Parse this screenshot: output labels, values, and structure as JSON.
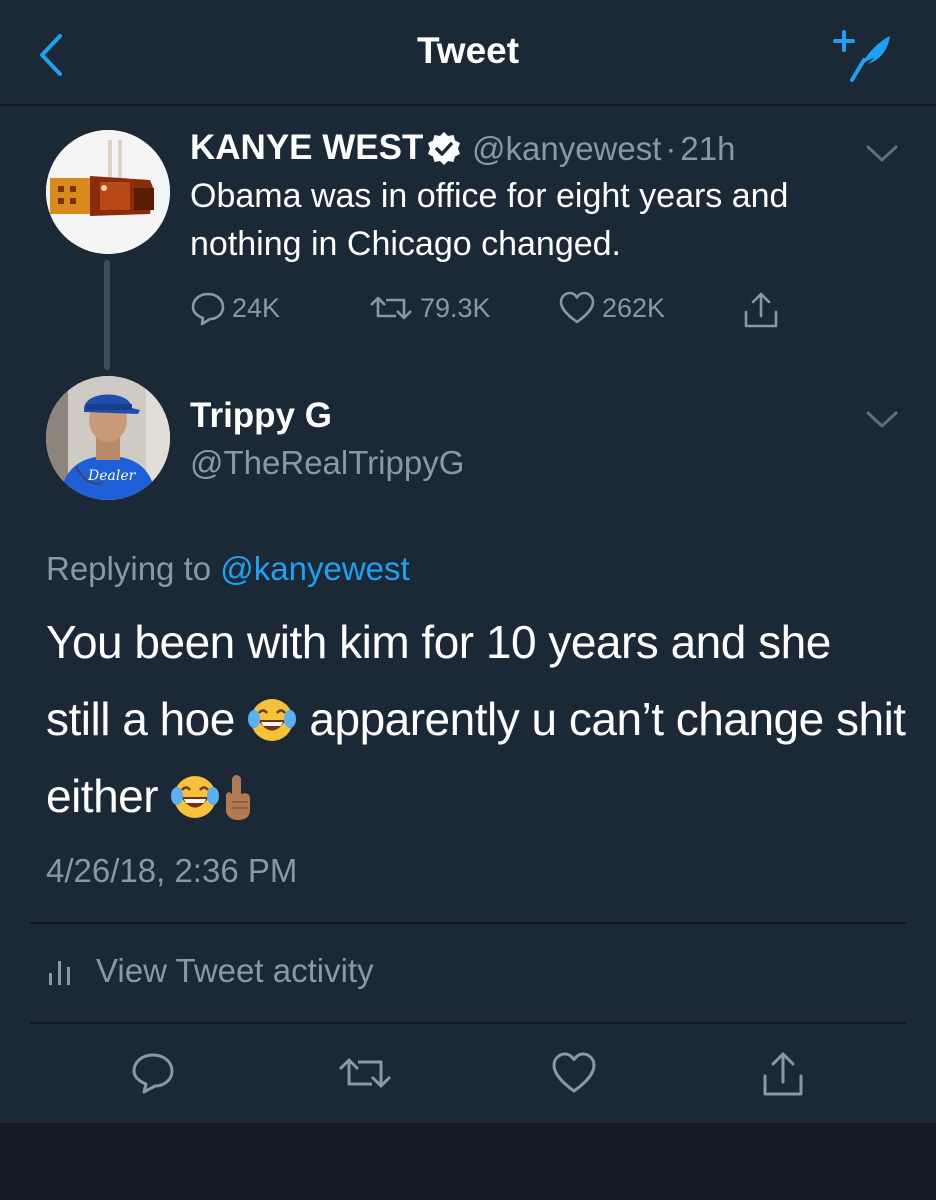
{
  "header": {
    "title": "Tweet"
  },
  "original_tweet": {
    "name": "KANYE WEST",
    "handle": "@kanyewest",
    "separator": "·",
    "time": "21h",
    "text": "Obama was in office for eight years and nothing in Chicago changed.",
    "replies": "24K",
    "retweets": "79.3K",
    "likes": "262K"
  },
  "reply_tweet": {
    "name": "Trippy G",
    "handle": "@TheRealTrippyG",
    "replying_label": "Replying to",
    "replying_to": "@kanyewest",
    "text_part1": "You been with kim for 10 years and she still a hoe ",
    "text_part2": " apparently u can’t change shit either ",
    "timestamp": "4/26/18, 2:36 PM",
    "activity_label": "View Tweet activity"
  },
  "colors": {
    "background": "#1b2836",
    "accent": "#1da1f2",
    "secondary_text": "#8899a6",
    "divider": "#0f1822"
  },
  "icons": [
    "back-arrow-icon",
    "compose-tweet-icon",
    "verified-badge-icon",
    "chevron-down-icon",
    "reply-icon",
    "retweet-icon",
    "like-icon",
    "share-icon",
    "activity-bars-icon",
    "laughing-emoji-icon",
    "pointing-up-emoji-icon"
  ]
}
